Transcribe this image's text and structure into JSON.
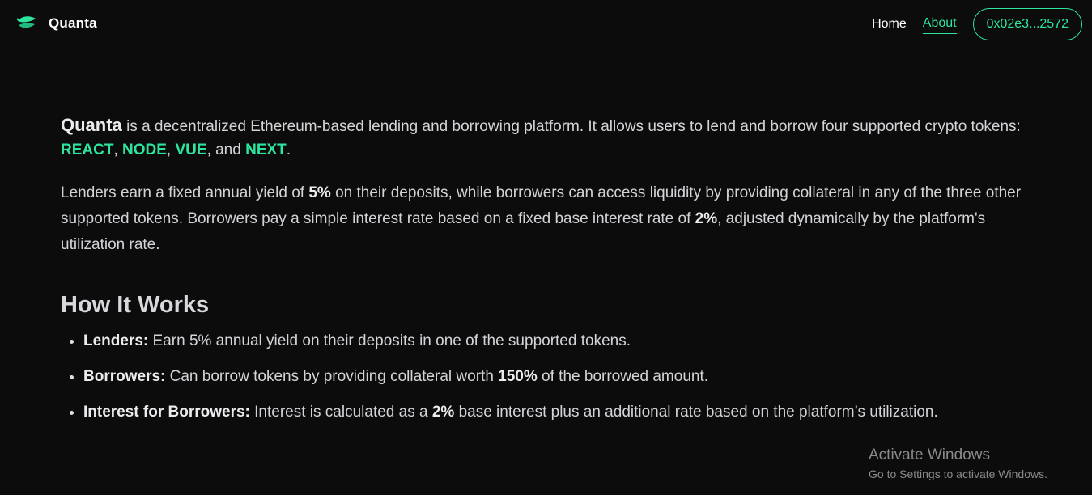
{
  "nav": {
    "brand": "Quanta",
    "links": [
      {
        "label": "Home",
        "active": false
      },
      {
        "label": "About",
        "active": true
      }
    ],
    "wallet_label": "0x02e3...2572"
  },
  "about": {
    "intro": {
      "brand": "Quanta",
      "text1": " is a decentralized Ethereum-based lending and borrowing platform. It allows users to lend and borrow four supported crypto tokens: ",
      "tokens": [
        "REACT",
        "NODE",
        "VUE",
        "NEXT"
      ],
      "sep1": ", ",
      "sep2": ", ",
      "sep3": ", and ",
      "end": "."
    },
    "para2": {
      "t1": "Lenders earn a fixed annual yield of ",
      "yield": "5%",
      "t2": " on their deposits, while borrowers can access liquidity by providing collateral in any of the three other supported tokens. Borrowers pay a simple interest rate based on a fixed base interest rate of ",
      "base_rate": "2%",
      "t3": ", adjusted dynamically by the platform's utilization rate."
    },
    "how_title": "How It Works",
    "items": [
      {
        "label": "Lenders:",
        "t1": " Earn 5% annual yield on their deposits in one of the supported tokens.",
        "bold": "",
        "t2": ""
      },
      {
        "label": "Borrowers:",
        "t1": " Can borrow tokens by providing collateral worth ",
        "bold": "150%",
        "t2": " of the borrowed amount."
      },
      {
        "label": "Interest for Borrowers:",
        "t1": " Interest is calculated as a ",
        "bold": "2%",
        "t2": " base interest plus an additional rate based on the platform’s utilization."
      }
    ]
  },
  "watermark": {
    "title": "Activate Windows",
    "subtitle": "Go to Settings to activate Windows."
  },
  "colors": {
    "accent": "#2ee59d",
    "background": "#0c0c0d"
  }
}
